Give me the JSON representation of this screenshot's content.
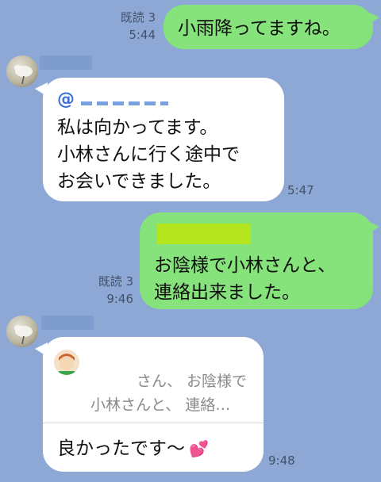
{
  "messages": {
    "m1": {
      "read": "既読 3",
      "time": "5:44",
      "text": "小雨降ってますね。"
    },
    "m2": {
      "mention": "@",
      "time": "5:47",
      "text": "私は向かってます。\n小林さんに行く途中で\nお会いできました。"
    },
    "m3": {
      "read": "既読 3",
      "time": "9:46",
      "text": "お陰様で小林さんと、\n連絡出来ました。"
    },
    "m4": {
      "reply_line1": "さん、 お陰様で",
      "reply_line2": "小林さんと、 連絡…",
      "text": "良かったです〜",
      "emoji": "💕",
      "time": "9:48"
    }
  },
  "colors": {
    "background": "#8da8d4",
    "outgoing_bubble": "#86e27a",
    "incoming_bubble": "#ffffff",
    "highlight": "#b5e61d"
  }
}
